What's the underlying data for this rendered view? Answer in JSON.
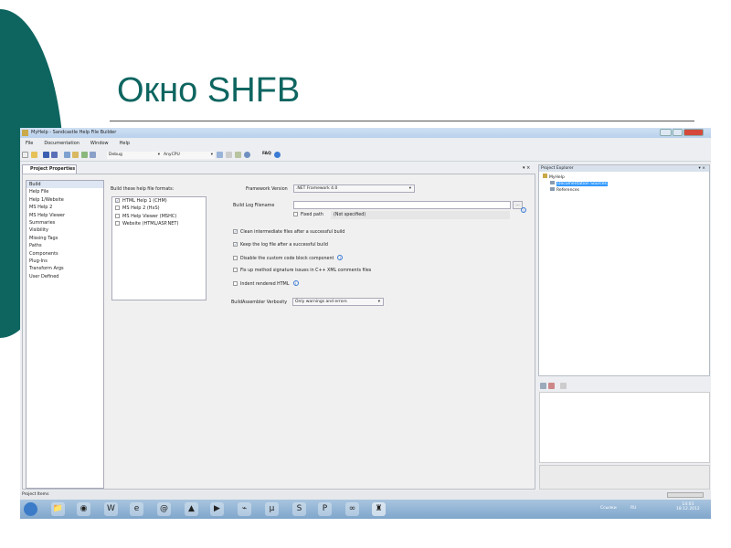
{
  "slide": {
    "title": "Окно SHFB",
    "accent": "#0e6560"
  },
  "window": {
    "title": "MyHelp - Sandcastle Help File Builder"
  },
  "menu": [
    "File",
    "Documentation",
    "Window",
    "Help"
  ],
  "toolbar": {
    "config": "Debug",
    "platform": "AnyCPU",
    "faq": "FAQ"
  },
  "tab": {
    "label": "Project Properties"
  },
  "nav": [
    "Build",
    "Help File",
    "Help 1/Website",
    "MS Help 2",
    "MS Help Viewer",
    "Summaries",
    "Visibility",
    "Missing Tags",
    "Paths",
    "Components",
    "Plug-Ins",
    "Transform Args",
    "User Defined"
  ],
  "formats": {
    "label": "Build these help file formats:",
    "items": [
      {
        "label": "HTML Help 1 (CHM)",
        "checked": true
      },
      {
        "label": "MS Help 2 (HxS)",
        "checked": false
      },
      {
        "label": "MS Help Viewer (MSHC)",
        "checked": false
      },
      {
        "label": "Website (HTML/ASP.NET)",
        "checked": false
      }
    ]
  },
  "build": {
    "framework_label": "Framework Version",
    "framework_value": ".NET Framework 4.0",
    "log_label": "Build Log Filename",
    "log_value": "",
    "browse": "...",
    "fixed_path": "Fixed path",
    "not_specified": "(Not specified)",
    "options": [
      {
        "label": "Clean intermediate files after a successful build",
        "checked": true
      },
      {
        "label": "Keep the log file after a successful build",
        "checked": true
      },
      {
        "label": "Disable the custom code block component",
        "checked": false
      },
      {
        "label": "Fix up method signature issues in C++ XML comments files",
        "checked": false
      },
      {
        "label": "Indent rendered HTML",
        "checked": false
      }
    ],
    "verbosity_label": "BuildAssembler Verbosity",
    "verbosity_value": "Only warnings and errors"
  },
  "explorer": {
    "title": "Project Explorer",
    "root": "MyHelp",
    "items": [
      "Documentation Sources",
      "References"
    ]
  },
  "status": {
    "text": "Project Items"
  },
  "tray": {
    "lang": "Ссылки",
    "kb": "RU",
    "time": "14:03",
    "date": "18.12.2012"
  }
}
